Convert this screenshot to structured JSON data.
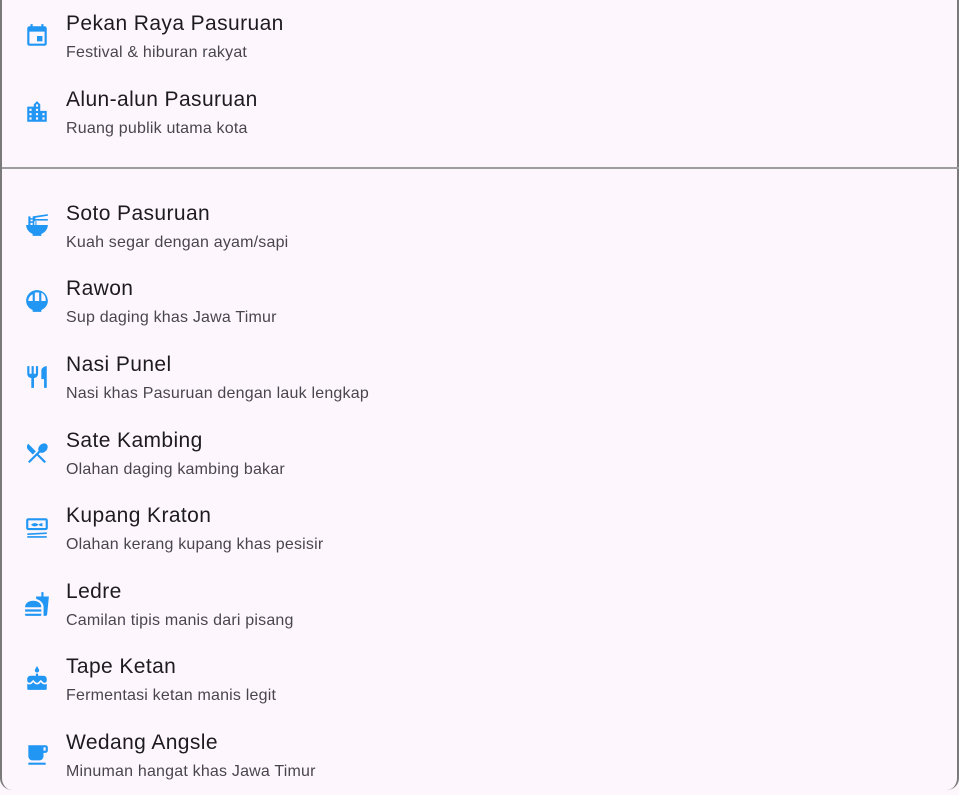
{
  "sections": [
    {
      "items": [
        {
          "title": "Pekan Raya Pasuruan",
          "subtitle": "Festival & hiburan rakyat",
          "icon": "event-calendar-icon"
        },
        {
          "title": "Alun-alun Pasuruan",
          "subtitle": "Ruang publik utama kota",
          "icon": "location-city-icon"
        }
      ]
    },
    {
      "items": [
        {
          "title": "Soto Pasuruan",
          "subtitle": "Kuah segar dengan ayam/sapi",
          "icon": "ramen-bowl-icon"
        },
        {
          "title": "Rawon",
          "subtitle": "Sup daging khas Jawa Timur",
          "icon": "rice-bowl-icon"
        },
        {
          "title": "Nasi Punel",
          "subtitle": "Nasi khas Pasuruan dengan lauk lengkap",
          "icon": "restaurant-icon"
        },
        {
          "title": "Sate Kambing",
          "subtitle": "Olahan daging kambing bakar",
          "icon": "dining-icon"
        },
        {
          "title": "Kupang Kraton",
          "subtitle": "Olahan kerang kupang khas pesisir",
          "icon": "set-meal-icon"
        },
        {
          "title": "Ledre",
          "subtitle": "Camilan tipis manis dari pisang",
          "icon": "fastfood-icon"
        },
        {
          "title": "Tape Ketan",
          "subtitle": "Fermentasi ketan manis legit",
          "icon": "cake-icon"
        },
        {
          "title": "Wedang Angsle",
          "subtitle": "Minuman hangat khas Jawa Timur",
          "icon": "coffee-cup-icon"
        }
      ]
    }
  ],
  "colors": {
    "accent": "#2196f3",
    "background": "#fdf7fd",
    "title": "#1d1b20",
    "subtitle": "#49454f"
  }
}
